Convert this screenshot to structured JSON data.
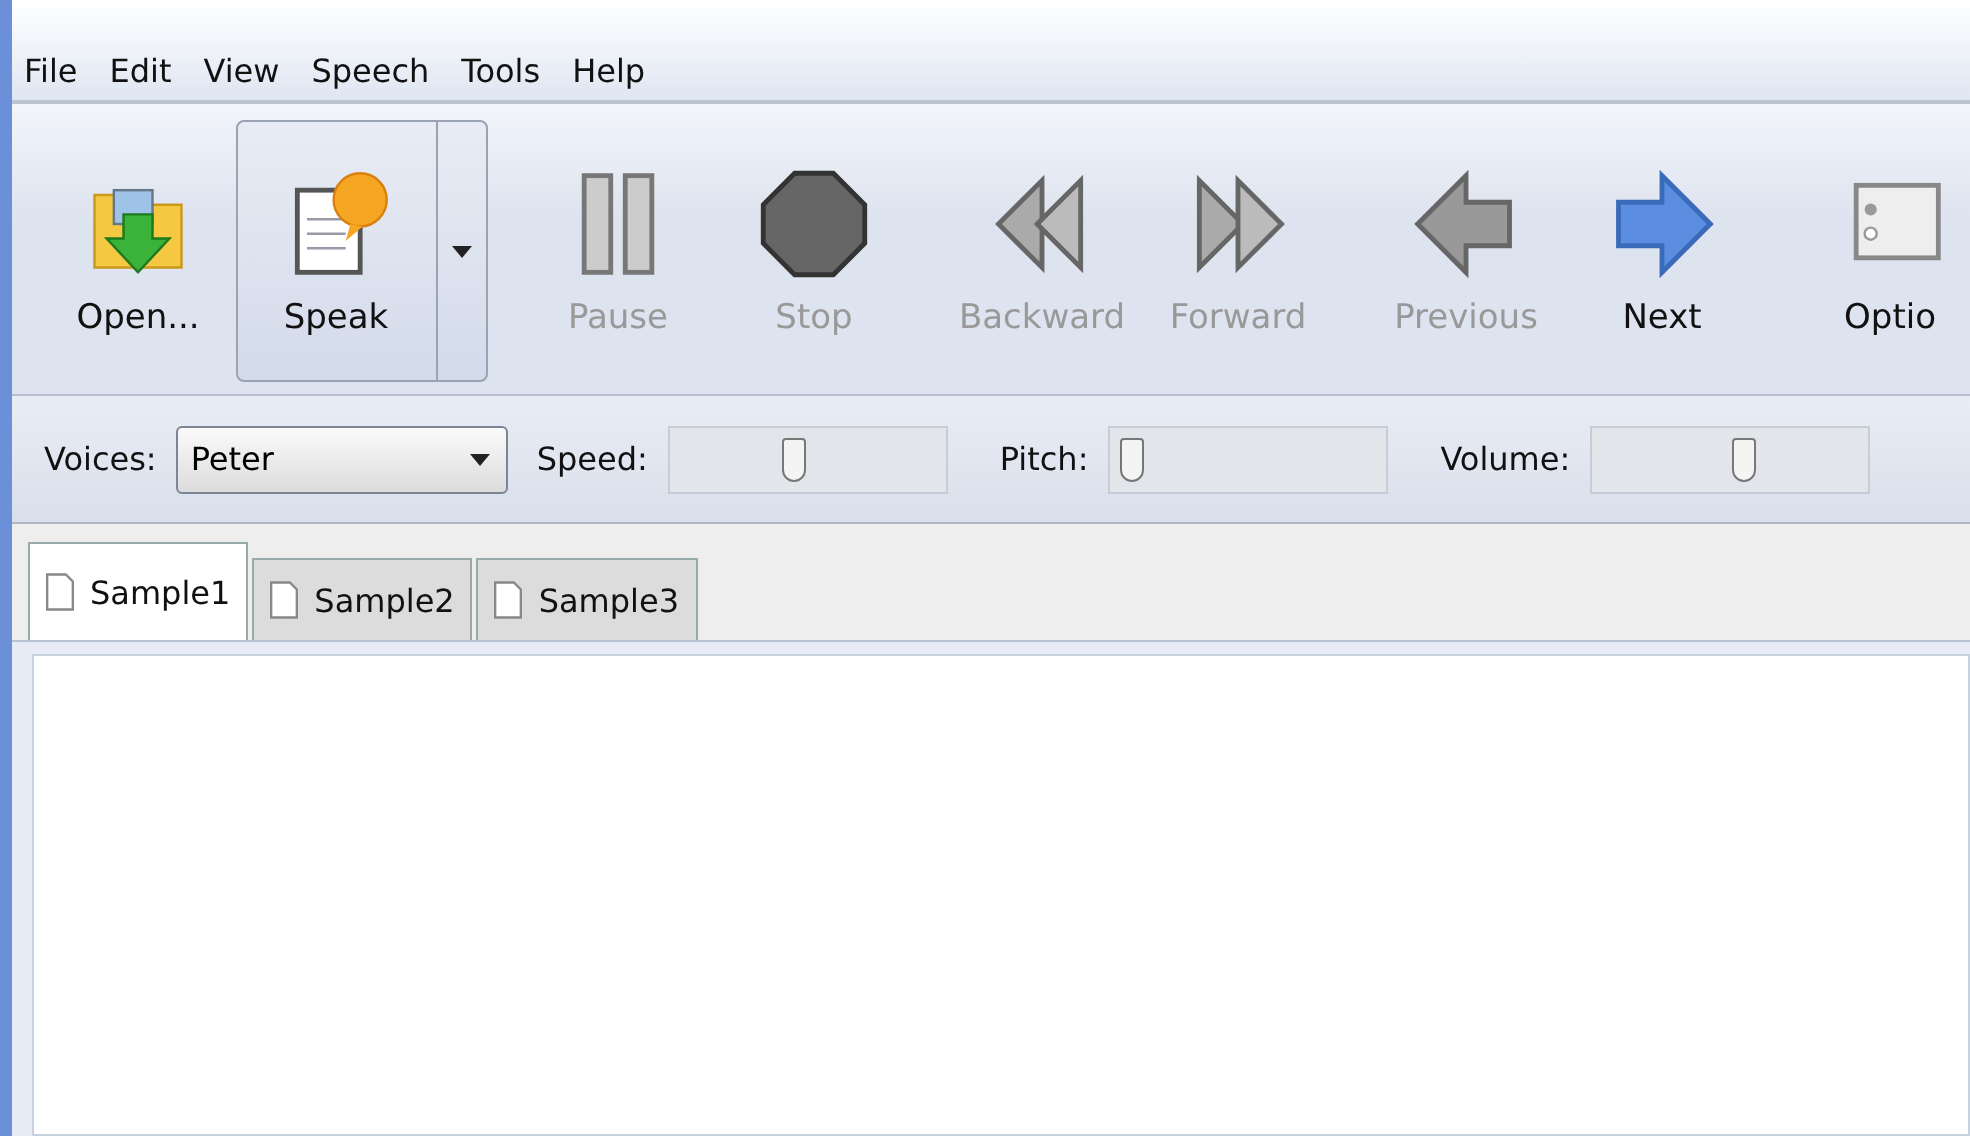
{
  "menu": [
    "File",
    "Edit",
    "View",
    "Speech",
    "Tools",
    "Help"
  ],
  "toolbar": [
    {
      "buttons": [
        {
          "kind": "open",
          "label": "Open...",
          "disabled": false,
          "split": false
        },
        {
          "kind": "speak",
          "label": "Speak",
          "disabled": false,
          "split": true
        }
      ]
    },
    {
      "buttons": [
        {
          "kind": "pause",
          "label": "Pause",
          "disabled": true,
          "split": false
        },
        {
          "kind": "stop",
          "label": "Stop",
          "disabled": true,
          "split": false
        }
      ]
    },
    {
      "buttons": [
        {
          "kind": "backward",
          "label": "Backward",
          "disabled": true,
          "split": false
        },
        {
          "kind": "forward",
          "label": "Forward",
          "disabled": true,
          "split": false
        }
      ]
    },
    {
      "buttons": [
        {
          "kind": "previous",
          "label": "Previous",
          "disabled": true,
          "split": false
        },
        {
          "kind": "next",
          "label": "Next",
          "disabled": false,
          "split": false
        }
      ]
    },
    {
      "buttons": [
        {
          "kind": "options",
          "label": "Optio",
          "disabled": false,
          "split": false
        }
      ]
    }
  ],
  "voices": {
    "label": "Voices:",
    "value": "Peter"
  },
  "sliders": [
    {
      "label": "Speed:",
      "level": 0.45
    },
    {
      "label": "Pitch:",
      "level": 0.08
    },
    {
      "label": "Volume:",
      "level": 0.55
    }
  ],
  "tabs": [
    {
      "label": "Sample1",
      "selected": true
    },
    {
      "label": "Sample2",
      "selected": false
    },
    {
      "label": "Sample3",
      "selected": false
    }
  ]
}
